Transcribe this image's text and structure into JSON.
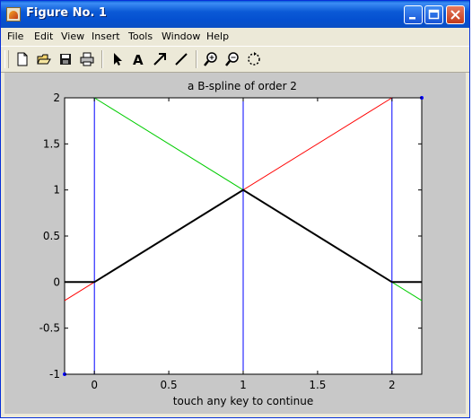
{
  "window": {
    "title": "Figure No. 1"
  },
  "menu": {
    "items": [
      "File",
      "Edit",
      "View",
      "Insert",
      "Tools",
      "Window",
      "Help"
    ]
  },
  "toolbar": {
    "icons": [
      "new-file-icon",
      "open-folder-icon",
      "save-icon",
      "print-icon",
      "select-arrow-icon",
      "insert-text-icon",
      "insert-arrow-icon",
      "insert-line-icon",
      "zoom-in-icon",
      "zoom-out-icon",
      "rotate-icon"
    ]
  },
  "chart_data": {
    "type": "line",
    "title": "a B-spline of order 2",
    "xlabel": "touch any key to continue",
    "ylabel": "",
    "xlim": [
      -0.2,
      2.2
    ],
    "ylim": [
      -1,
      2
    ],
    "xticks": [
      "0",
      "0.5",
      "1",
      "1.5",
      "2"
    ],
    "xtick_values": [
      0,
      0.5,
      1,
      1.5,
      2
    ],
    "yticks": [
      "-1",
      "-0.5",
      "0",
      "0.5",
      "1",
      "1.5",
      "2"
    ],
    "ytick_values": [
      -1,
      -0.5,
      0,
      0.5,
      1,
      1.5,
      2
    ],
    "grid": false,
    "series": [
      {
        "color": "#ff0000",
        "x": [
          -0.2,
          2
        ],
        "y": [
          -0.2,
          2
        ]
      },
      {
        "color": "#00cc00",
        "x": [
          0,
          2.2
        ],
        "y": [
          2,
          -0.2
        ]
      },
      {
        "color": "#000000",
        "x": [
          -0.2,
          0,
          1,
          2,
          2.2
        ],
        "y": [
          0,
          0,
          1,
          0,
          0
        ]
      },
      {
        "color": "#0000ff",
        "x": [
          0,
          0
        ],
        "y": [
          -1,
          2
        ]
      },
      {
        "color": "#0000ff",
        "x": [
          1,
          1
        ],
        "y": [
          -1,
          2
        ]
      },
      {
        "color": "#0000ff",
        "x": [
          2,
          2
        ],
        "y": [
          -1,
          2
        ]
      }
    ],
    "markers": [
      {
        "color": "#0000ff",
        "x": -0.2,
        "y": -1
      },
      {
        "color": "#0000ff",
        "x": 2.2,
        "y": 2
      }
    ]
  }
}
